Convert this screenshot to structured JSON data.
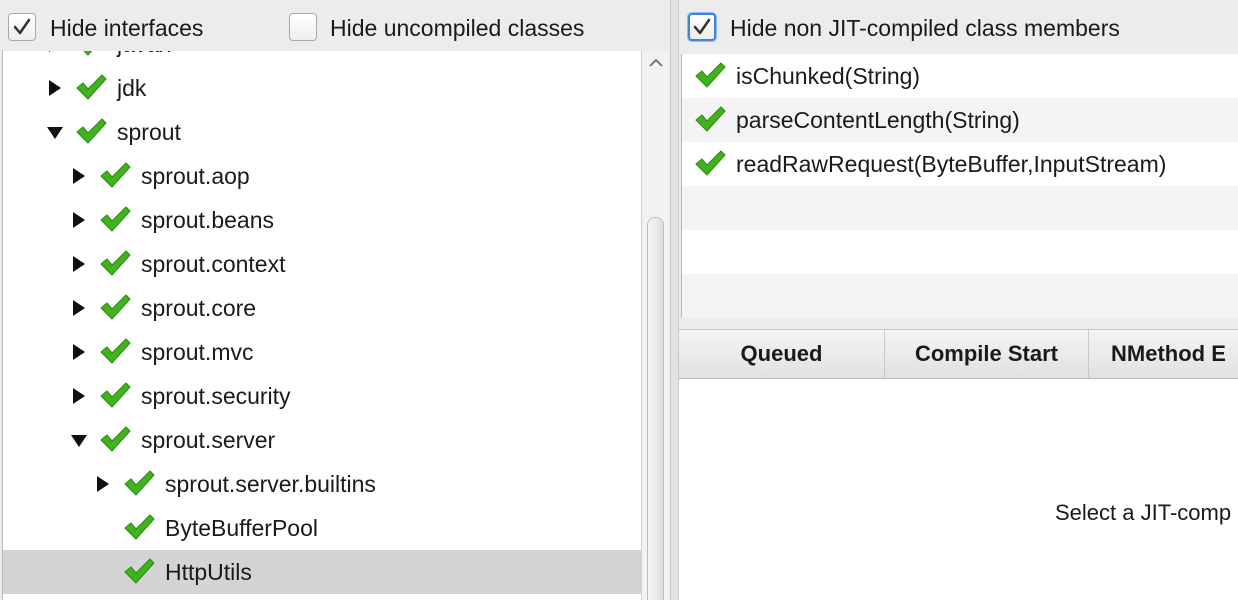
{
  "left": {
    "hide_interfaces": {
      "label": "Hide interfaces",
      "checked": true
    },
    "hide_uncompiled": {
      "label": "Hide uncompiled classes",
      "checked": false
    },
    "tree": [
      {
        "label": "javax",
        "depth": 0,
        "expander": "right",
        "selected": false
      },
      {
        "label": "jdk",
        "depth": 0,
        "expander": "right",
        "selected": false
      },
      {
        "label": "sprout",
        "depth": 0,
        "expander": "down",
        "selected": false
      },
      {
        "label": "sprout.aop",
        "depth": 1,
        "expander": "right",
        "selected": false
      },
      {
        "label": "sprout.beans",
        "depth": 1,
        "expander": "right",
        "selected": false
      },
      {
        "label": "sprout.context",
        "depth": 1,
        "expander": "right",
        "selected": false
      },
      {
        "label": "sprout.core",
        "depth": 1,
        "expander": "right",
        "selected": false
      },
      {
        "label": "sprout.mvc",
        "depth": 1,
        "expander": "right",
        "selected": false
      },
      {
        "label": "sprout.security",
        "depth": 1,
        "expander": "right",
        "selected": false
      },
      {
        "label": "sprout.server",
        "depth": 1,
        "expander": "down",
        "selected": false
      },
      {
        "label": "sprout.server.builtins",
        "depth": 2,
        "expander": "right",
        "selected": false
      },
      {
        "label": "ByteBufferPool",
        "depth": 2,
        "expander": "none",
        "selected": false
      },
      {
        "label": "HttpUtils",
        "depth": 2,
        "expander": "none",
        "selected": true
      }
    ]
  },
  "right": {
    "hide_non_jit": {
      "label": "Hide non JIT-compiled class members",
      "checked": true
    },
    "members": [
      {
        "label": "isChunked(String)"
      },
      {
        "label": "parseContentLength(String)"
      },
      {
        "label": "readRawRequest(ByteBuffer,InputStream)"
      }
    ],
    "compile_table": {
      "columns": [
        "Queued",
        "Compile Start",
        "NMethod E"
      ],
      "empty_message": "Select a JIT-comp"
    }
  },
  "colors": {
    "check_green": "#3fb21c",
    "focus_blue": "#3f84d6",
    "selected_row": "#d4d4d4"
  },
  "icons": {
    "tree_node": "green-check-icon",
    "checkbox": "checkbox-check-icon"
  }
}
